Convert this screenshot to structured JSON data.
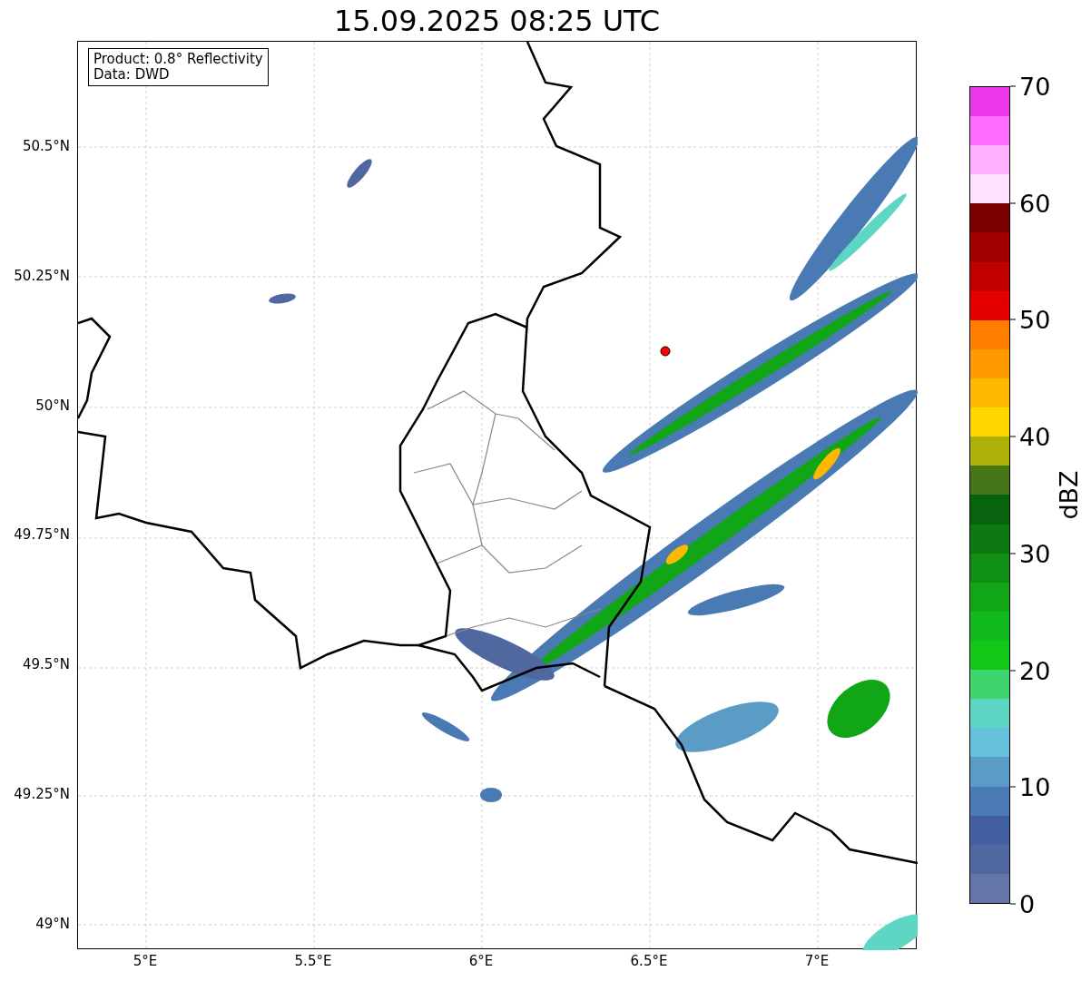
{
  "title": "15.09.2025 08:25 UTC",
  "map": {
    "legend": [
      "Product: 0.8° Reflectivity",
      "Data: DWD"
    ],
    "yticks": [
      "50.5°N",
      "50.25°N",
      "50°N",
      "49.75°N",
      "49.5°N",
      "49.25°N",
      "49°N"
    ],
    "xticks": [
      "5°E",
      "5.5°E",
      "6°E",
      "6.5°E",
      "7°E"
    ]
  },
  "colorbar": {
    "label": "dBZ",
    "ticks": [
      "70",
      "60",
      "50",
      "40",
      "30",
      "20",
      "10",
      "0"
    ],
    "segments": [
      {
        "color": "#6475a8"
      },
      {
        "color": "#5167a0"
      },
      {
        "color": "#4360a4"
      },
      {
        "color": "#4a7ab3"
      },
      {
        "color": "#5a9cc6"
      },
      {
        "color": "#66c2dc"
      },
      {
        "color": "#5dd6c4"
      },
      {
        "color": "#3ed56e"
      },
      {
        "color": "#12c817"
      },
      {
        "color": "#10b91e"
      },
      {
        "color": "#10a616"
      },
      {
        "color": "#0f8f14"
      },
      {
        "color": "#0c7a10"
      },
      {
        "color": "#07630e"
      },
      {
        "color": "#467617"
      },
      {
        "color": "#aeb108"
      },
      {
        "color": "#ffd600"
      },
      {
        "color": "#ffb800"
      },
      {
        "color": "#ff9b00"
      },
      {
        "color": "#ff7e00"
      },
      {
        "color": "#e50000"
      },
      {
        "color": "#c20000"
      },
      {
        "color": "#a00000"
      },
      {
        "color": "#7b0000"
      },
      {
        "color": "#ffe0ff"
      },
      {
        "color": "#ffb0ff"
      },
      {
        "color": "#ff6cff"
      },
      {
        "color": "#ea38ea"
      }
    ]
  }
}
